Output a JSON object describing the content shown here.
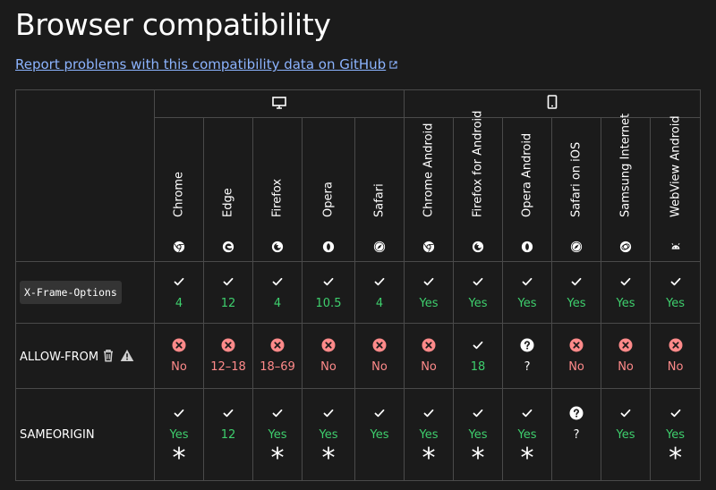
{
  "page": {
    "title": "Browser compatibility",
    "report_link": "Report problems with this compatibility data on GitHub"
  },
  "platforms": [
    {
      "name": "desktop-icon",
      "span": 5
    },
    {
      "name": "mobile-icon",
      "span": 6
    }
  ],
  "browsers": [
    {
      "name": "Chrome",
      "icon": "chrome-icon"
    },
    {
      "name": "Edge",
      "icon": "edge-icon"
    },
    {
      "name": "Firefox",
      "icon": "firefox-icon"
    },
    {
      "name": "Opera",
      "icon": "opera-icon"
    },
    {
      "name": "Safari",
      "icon": "safari-icon"
    },
    {
      "name": "Chrome Android",
      "icon": "chrome-icon"
    },
    {
      "name": "Firefox for Android",
      "icon": "firefox-icon"
    },
    {
      "name": "Opera Android",
      "icon": "opera-icon"
    },
    {
      "name": "Safari on iOS",
      "icon": "safari-icon"
    },
    {
      "name": "Samsung Internet",
      "icon": "samsung-internet-icon"
    },
    {
      "name": "WebView Android",
      "icon": "android-icon"
    }
  ],
  "features": [
    {
      "name": "X-Frame-Options",
      "code": true,
      "cells": [
        {
          "status": "yes",
          "text": "4"
        },
        {
          "status": "yes",
          "text": "12"
        },
        {
          "status": "yes",
          "text": "4"
        },
        {
          "status": "yes",
          "text": "10.5"
        },
        {
          "status": "yes",
          "text": "4"
        },
        {
          "status": "yes",
          "text": "Yes"
        },
        {
          "status": "yes",
          "text": "Yes"
        },
        {
          "status": "yes",
          "text": "Yes"
        },
        {
          "status": "yes",
          "text": "Yes"
        },
        {
          "status": "yes",
          "text": "Yes"
        },
        {
          "status": "yes",
          "text": "Yes"
        }
      ]
    },
    {
      "name": "ALLOW-FROM",
      "code": false,
      "deprecated": true,
      "warning": true,
      "cells": [
        {
          "status": "no",
          "text": "No"
        },
        {
          "status": "no",
          "text": "12–18"
        },
        {
          "status": "no",
          "text": "18–69"
        },
        {
          "status": "no",
          "text": "No"
        },
        {
          "status": "no",
          "text": "No"
        },
        {
          "status": "no",
          "text": "No"
        },
        {
          "status": "yes",
          "text": "18"
        },
        {
          "status": "unknown",
          "text": "?"
        },
        {
          "status": "no",
          "text": "No"
        },
        {
          "status": "no",
          "text": "No"
        },
        {
          "status": "no",
          "text": "No"
        }
      ]
    },
    {
      "name": "SAMEORIGIN",
      "code": false,
      "cells": [
        {
          "status": "yes",
          "text": "Yes",
          "note": "*"
        },
        {
          "status": "yes",
          "text": "12"
        },
        {
          "status": "yes",
          "text": "Yes",
          "note": "*"
        },
        {
          "status": "yes",
          "text": "Yes",
          "note": "*"
        },
        {
          "status": "yes",
          "text": "Yes"
        },
        {
          "status": "yes",
          "text": "Yes",
          "note": "*"
        },
        {
          "status": "yes",
          "text": "Yes",
          "note": "*"
        },
        {
          "status": "yes",
          "text": "Yes",
          "note": "*"
        },
        {
          "status": "unknown",
          "text": "?"
        },
        {
          "status": "yes",
          "text": "Yes"
        },
        {
          "status": "yes",
          "text": "Yes",
          "note": "*"
        }
      ]
    }
  ]
}
